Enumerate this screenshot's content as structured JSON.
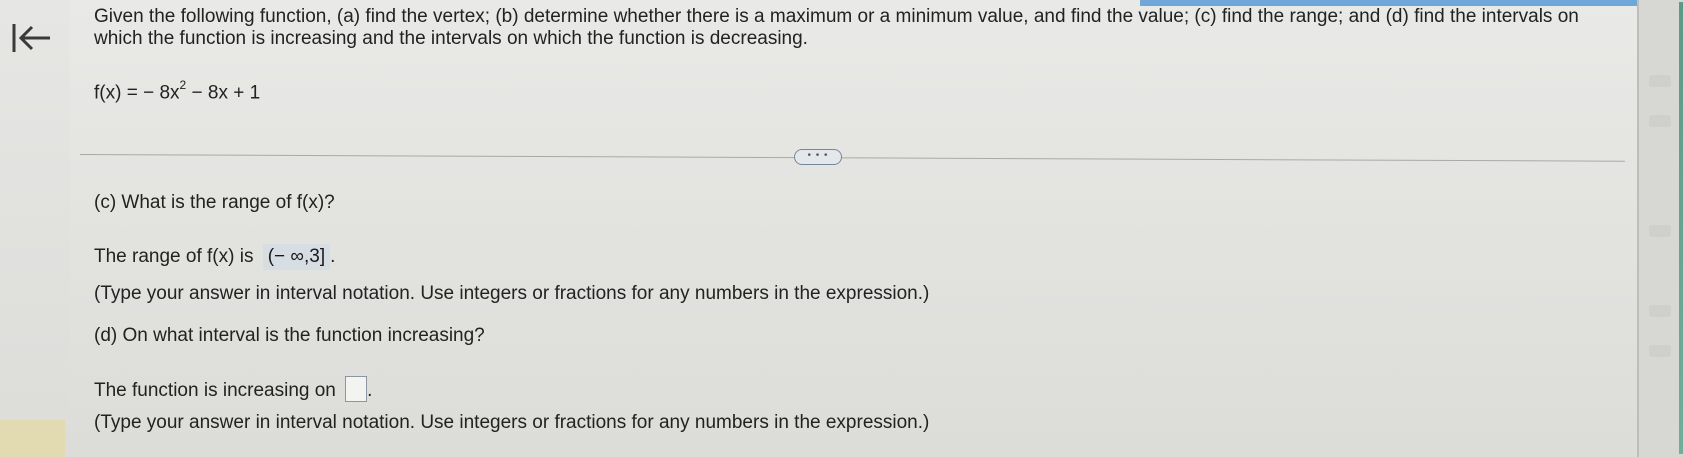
{
  "icons": {
    "back": "back-to-start-arrow-icon"
  },
  "question": {
    "prompt": "Given the following function, (a) find the vertex; (b) determine whether there is a maximum or a minimum value, and find the value; (c) find the range; and (d) find the intervals on which the function is increasing and the intervals on which the function is decreasing.",
    "function_prefix": "f(x) = − 8x",
    "function_exponent": "2",
    "function_suffix": " − 8x + 1"
  },
  "divider": {
    "ellipsis_label": "• • •"
  },
  "part_c": {
    "question": "(c) What is the range of f(x)?",
    "answer_prefix": "The range of f(x) is",
    "answer_value": "(− ∞,3]",
    "answer_suffix": ".",
    "hint": "(Type your answer in interval notation. Use integers or fractions for any numbers in the expression.)"
  },
  "part_d": {
    "question": "(d) On what interval is the function increasing?",
    "answer_prefix": "The function is increasing on",
    "answer_value": "",
    "answer_suffix": ".",
    "hint": "(Type your answer in interval notation. Use integers or fractions for any numbers in the expression.)"
  },
  "colors": {
    "top_accent": "#6fa7d8",
    "side_accent": "#5b9a86",
    "answer_box": "#d6dde3"
  }
}
